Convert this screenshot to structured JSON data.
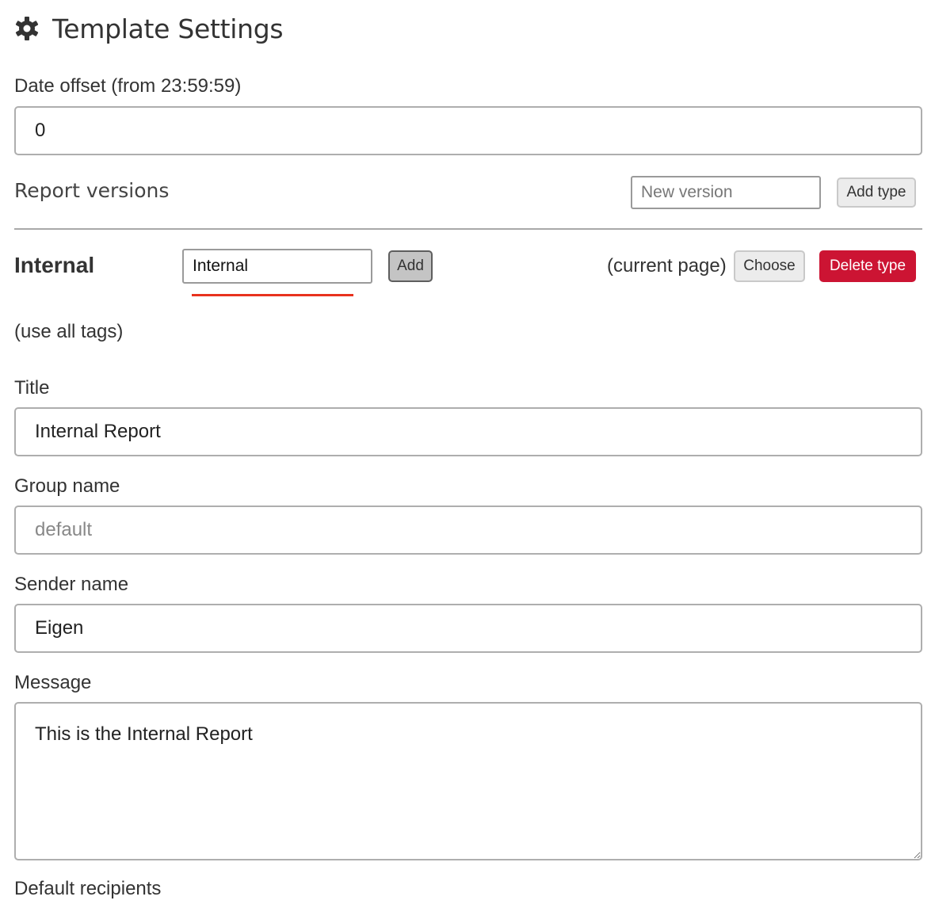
{
  "header": {
    "title": "Template Settings",
    "icon": "gear-icon"
  },
  "date_offset": {
    "label": "Date offset (from 23:59:59)",
    "value": "0"
  },
  "report_versions": {
    "title": "Report versions",
    "new_version_placeholder": "New version",
    "add_type_label": "Add type"
  },
  "version": {
    "name": "Internal",
    "input_value": "Internal",
    "add_label": "Add",
    "current_page_text": "(current page)",
    "choose_label": "Choose",
    "delete_type_label": "Delete type",
    "tags_note": "(use all tags)"
  },
  "form": {
    "title_label": "Title",
    "title_value": "Internal Report",
    "group_name_label": "Group name",
    "group_name_placeholder": "default",
    "sender_name_label": "Sender name",
    "sender_name_value": "Eigen",
    "message_label": "Message",
    "message_value": "This is the Internal Report",
    "default_recipients_label": "Default recipients"
  },
  "colors": {
    "delete_button": "#cc1433",
    "spellcheck_underline": "#e8321e"
  }
}
